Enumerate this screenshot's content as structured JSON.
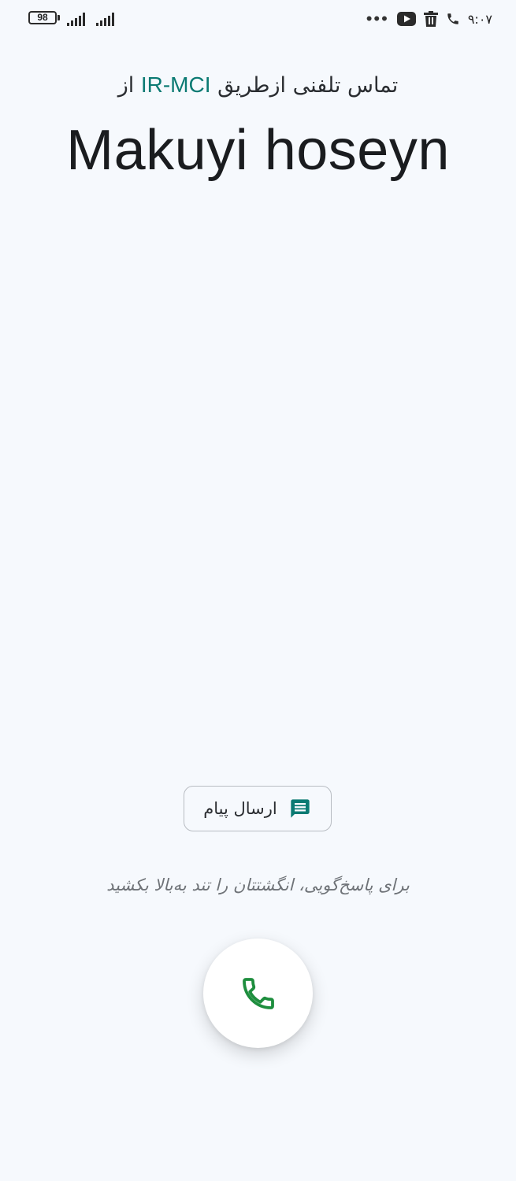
{
  "status_bar": {
    "battery_level": "98",
    "time": "۹:۰۷",
    "icons": [
      "battery-icon",
      "signal-icon",
      "signal-icon",
      "more-dots-icon",
      "youtube-icon",
      "trash-icon",
      "phone-icon"
    ],
    "more_indicator": "•••"
  },
  "call": {
    "via_prefix": "تماس تلفنی ازطریق",
    "carrier": "IR-MCI",
    "via_suffix": "از",
    "caller_name": "Makuyi hoseyn"
  },
  "actions": {
    "message_label": "ارسال پیام",
    "message_icon": "message-icon",
    "answer_icon": "phone-icon",
    "hint": "برای پاسخ‌گویی، انگشتتان را تند به‌بالا بکشید"
  },
  "colors": {
    "accent": "#0b7a73",
    "answer_green": "#1e8e3e",
    "background": "#f6f9fd"
  }
}
